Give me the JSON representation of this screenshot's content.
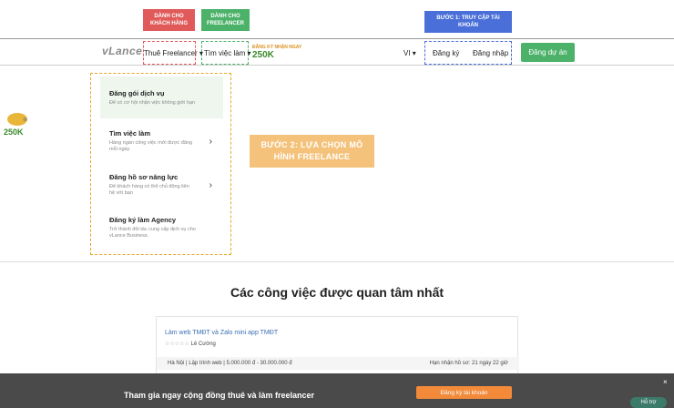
{
  "callouts": {
    "client": "DÀNH CHO KHÁCH HÀNG",
    "freelancer": "DÀNH CHO FREELANCER",
    "step1": "BƯỚC 1: TRUY CẬP TÀI KHOẢN",
    "step2": "BƯỚC 2: LỰA CHỌN MÔ HÌNH FREELANCE"
  },
  "nav": {
    "logo": "vLance",
    "hire": "Thuê Freelancer ▾",
    "find": "Tìm việc làm ▾",
    "promo_top": "ĐĂNG KÝ NHẬN NGAY",
    "promo_amount": "250K",
    "lang": "VI ▾",
    "register": "Đăng ký",
    "login": "Đăng nhập",
    "post": "Đăng dự án"
  },
  "dropdown": [
    {
      "title": "Đăng gói dịch vụ",
      "desc": "Để có cơ hội nhận việc không giới hạn",
      "chevron": ""
    },
    {
      "title": "Tìm việc làm",
      "desc": "Hàng ngàn công việc mới được đăng mỗi ngày",
      "chevron": "›"
    },
    {
      "title": "Đăng hồ sơ năng lực",
      "desc": "Để khách hàng có thể chủ động liên hệ với bạn",
      "chevron": "›"
    },
    {
      "title": "Đăng ký làm Agency",
      "desc": "Trở thành đối tác cung cấp dịch vụ cho vLance Business.",
      "chevron": ""
    }
  ],
  "side_promo": {
    "amount": "250K",
    "close": "⊗"
  },
  "section": {
    "title": "Các công việc được quan tâm nhất"
  },
  "job": {
    "title": "Làm web TMĐT và Zalo mini app TMĐT",
    "stars": "☆☆☆☆☆",
    "owner": "Lê Cường",
    "meta_left": "Hà Nội | Lập trình web | 5.000.000 đ - 30.000.000 đ",
    "meta_right": "Hạn nhận hồ sơ: 21 ngày 22 giờ"
  },
  "banner": {
    "sub": "Tham gia ngay cộng đồng thuê và làm freelancer",
    "text": "Tham gia ngay cộng đồng thuê và làm freelancer",
    "button": "Đăng ký tài khoản",
    "close": "×",
    "support": "Hỗ trợ"
  }
}
